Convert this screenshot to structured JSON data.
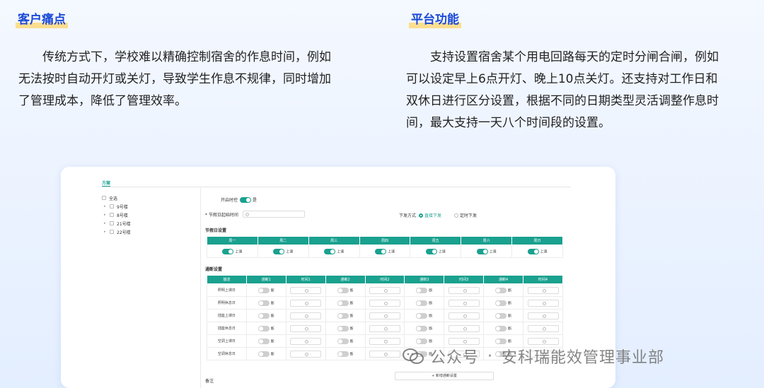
{
  "left": {
    "title": "客户痛点",
    "lines": [
      "传统方式下，学校难以精确控制宿舍的作息时间，例如",
      "无法按时自动开灯或关灯，导致学生作息不规律，同时增加",
      "了管理成本，降低了管理效率。"
    ]
  },
  "right": {
    "title": "平台功能",
    "lines": [
      "支持设置宿舍某个用电回路每天的定时分闸合闸，例如",
      "可以设定早上6点开灯、晚上10点关灯。还支持对工作日和",
      "双休日进行区分设置，根据不同的日期类型灵活调整作息时",
      "间，最大支持一天八个时间段的设置。"
    ]
  },
  "ui": {
    "tab": "方案",
    "tree": {
      "all": "全选",
      "buildings": [
        "9号楼",
        "8号楼",
        "21号楼",
        "22号楼"
      ]
    },
    "enable_label": "开启时控",
    "enable_value": "是",
    "festival_start_label": "* 节假日起始时间",
    "issue_label": "下发方式",
    "issue_options": [
      "直接下发",
      "定时下发"
    ],
    "holiday_section": "节假日设置",
    "weekdays": [
      "周一",
      "周二",
      "周三",
      "周四",
      "周五",
      "周六",
      "周日"
    ],
    "class_label": "上课",
    "schedule_section": "通断设置",
    "schedule_headers": [
      "描述",
      "通断1",
      "时间1",
      "通断2",
      "时间2",
      "通断3",
      "时间3",
      "通断4",
      "时间4"
    ],
    "off_label": "断",
    "schedule_rows": [
      "照明上课日",
      "照明休息日",
      "插座上课日",
      "插座休息日",
      "空调上课日",
      "空调休息日"
    ],
    "add_button": "+ 新增通断设置",
    "note_label": "备注"
  },
  "watermark": {
    "account": "公众号",
    "separator": "·",
    "org": "安科瑞能效管理事业部"
  }
}
